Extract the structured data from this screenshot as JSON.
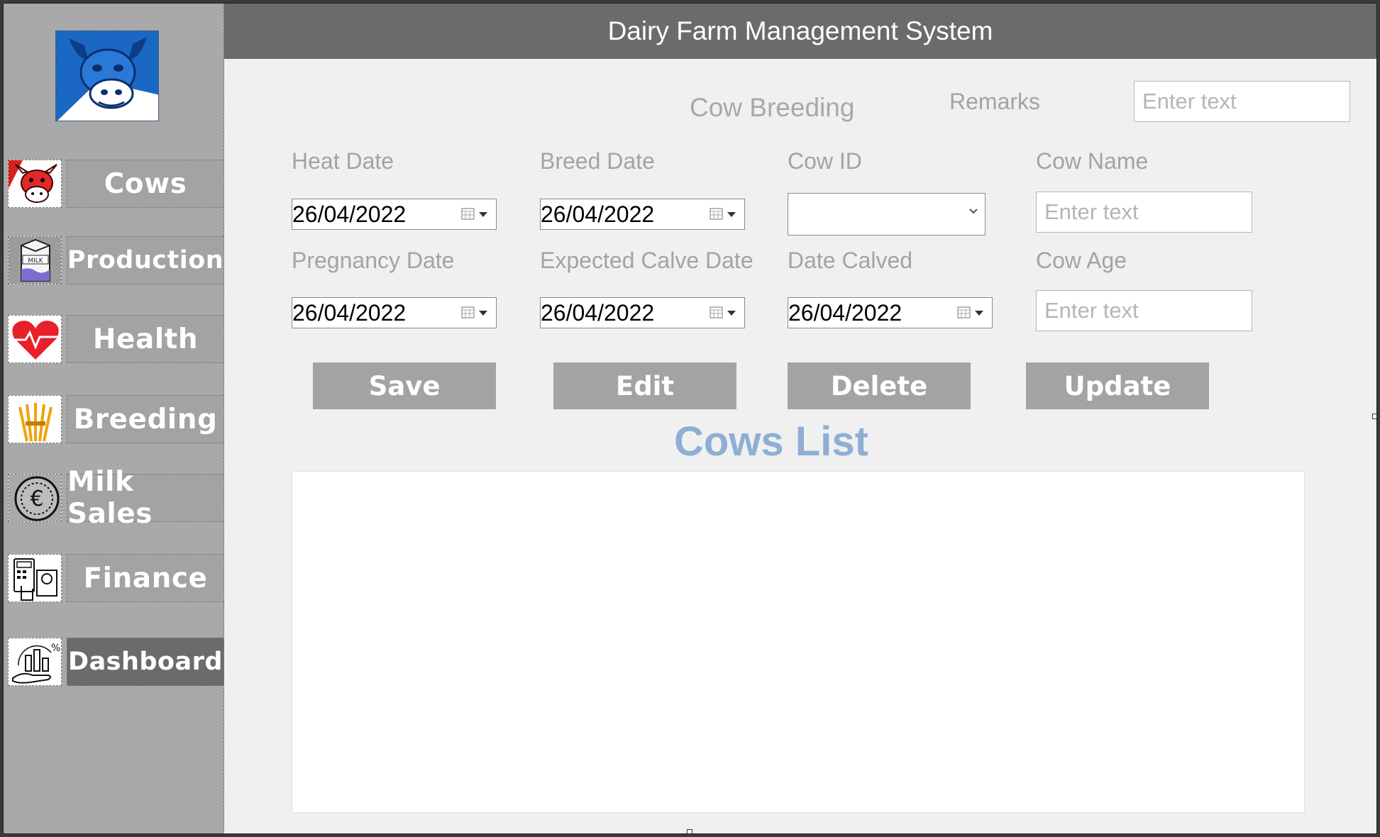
{
  "app": {
    "title": "Dairy Farm Management System"
  },
  "sidebar": {
    "items": [
      {
        "label": "Cows",
        "icon": "cow-icon"
      },
      {
        "label": "Production",
        "icon": "milk-carton-icon"
      },
      {
        "label": "Health",
        "icon": "heartbeat-icon"
      },
      {
        "label": "Breeding",
        "icon": "wheat-icon"
      },
      {
        "label": "Milk Sales",
        "icon": "euro-coin-icon"
      },
      {
        "label": "Finance",
        "icon": "calculator-chart-icon"
      },
      {
        "label": "Dashboard",
        "icon": "dashboard-chart-icon"
      }
    ],
    "active": "Dashboard"
  },
  "form": {
    "title": "Cow Breeding",
    "remarks": {
      "label": "Remarks",
      "placeholder": "Enter text",
      "value": ""
    },
    "heat_date": {
      "label": "Heat Date",
      "value": "26/04/2022"
    },
    "breed_date": {
      "label": "Breed Date",
      "value": "26/04/2022"
    },
    "cow_id": {
      "label": "Cow ID",
      "value": ""
    },
    "cow_name": {
      "label": "Cow Name",
      "placeholder": "Enter text",
      "value": ""
    },
    "pregnancy_date": {
      "label": "Pregnancy Date",
      "value": "26/04/2022"
    },
    "expected_calve_date": {
      "label": "Expected Calve Date",
      "value": "26/04/2022"
    },
    "date_calved": {
      "label": "Date Calved",
      "value": "26/04/2022"
    },
    "cow_age": {
      "label": "Cow Age",
      "placeholder": "Enter text",
      "value": ""
    }
  },
  "buttons": {
    "save": "Save",
    "edit": "Edit",
    "delete": "Delete",
    "update": "Update"
  },
  "list": {
    "title": "Cows List",
    "rows": []
  },
  "colors": {
    "header": "#6b6b6b",
    "sidebar": "#a9a9a9",
    "button": "#a3a3a3",
    "active_nav": "#6b6b6b",
    "list_title": "#8eaed4",
    "logo_blue": "#1a67c4"
  }
}
